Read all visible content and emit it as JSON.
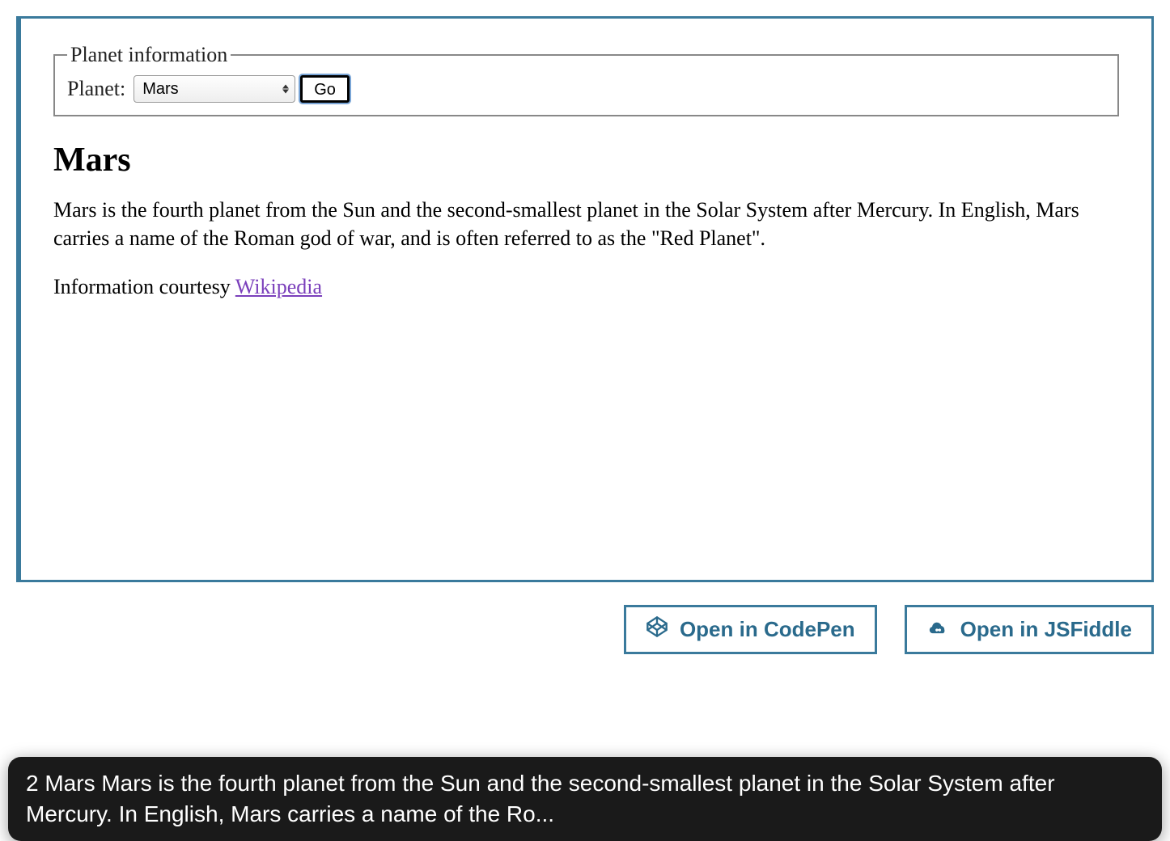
{
  "fieldset": {
    "legend": "Planet information",
    "label": "Planet:",
    "selected": "Mars",
    "go_label": "Go"
  },
  "planet": {
    "title": "Mars",
    "description": "Mars is the fourth planet from the Sun and the second-smallest planet in the Solar System after Mercury. In English, Mars carries a name of the Roman god of war, and is often referred to as the \"Red Planet\".",
    "courtesy_prefix": "Information courtesy ",
    "courtesy_link_text": "Wikipedia"
  },
  "actions": {
    "codepen_label": "Open in CodePen",
    "jsfiddle_label": "Open in JSFiddle"
  },
  "tooltip": {
    "text": "2  Mars Mars is the fourth planet from the Sun and the second-smallest planet in the Solar System after Mercury. In English, Mars carries a name of the Ro..."
  }
}
